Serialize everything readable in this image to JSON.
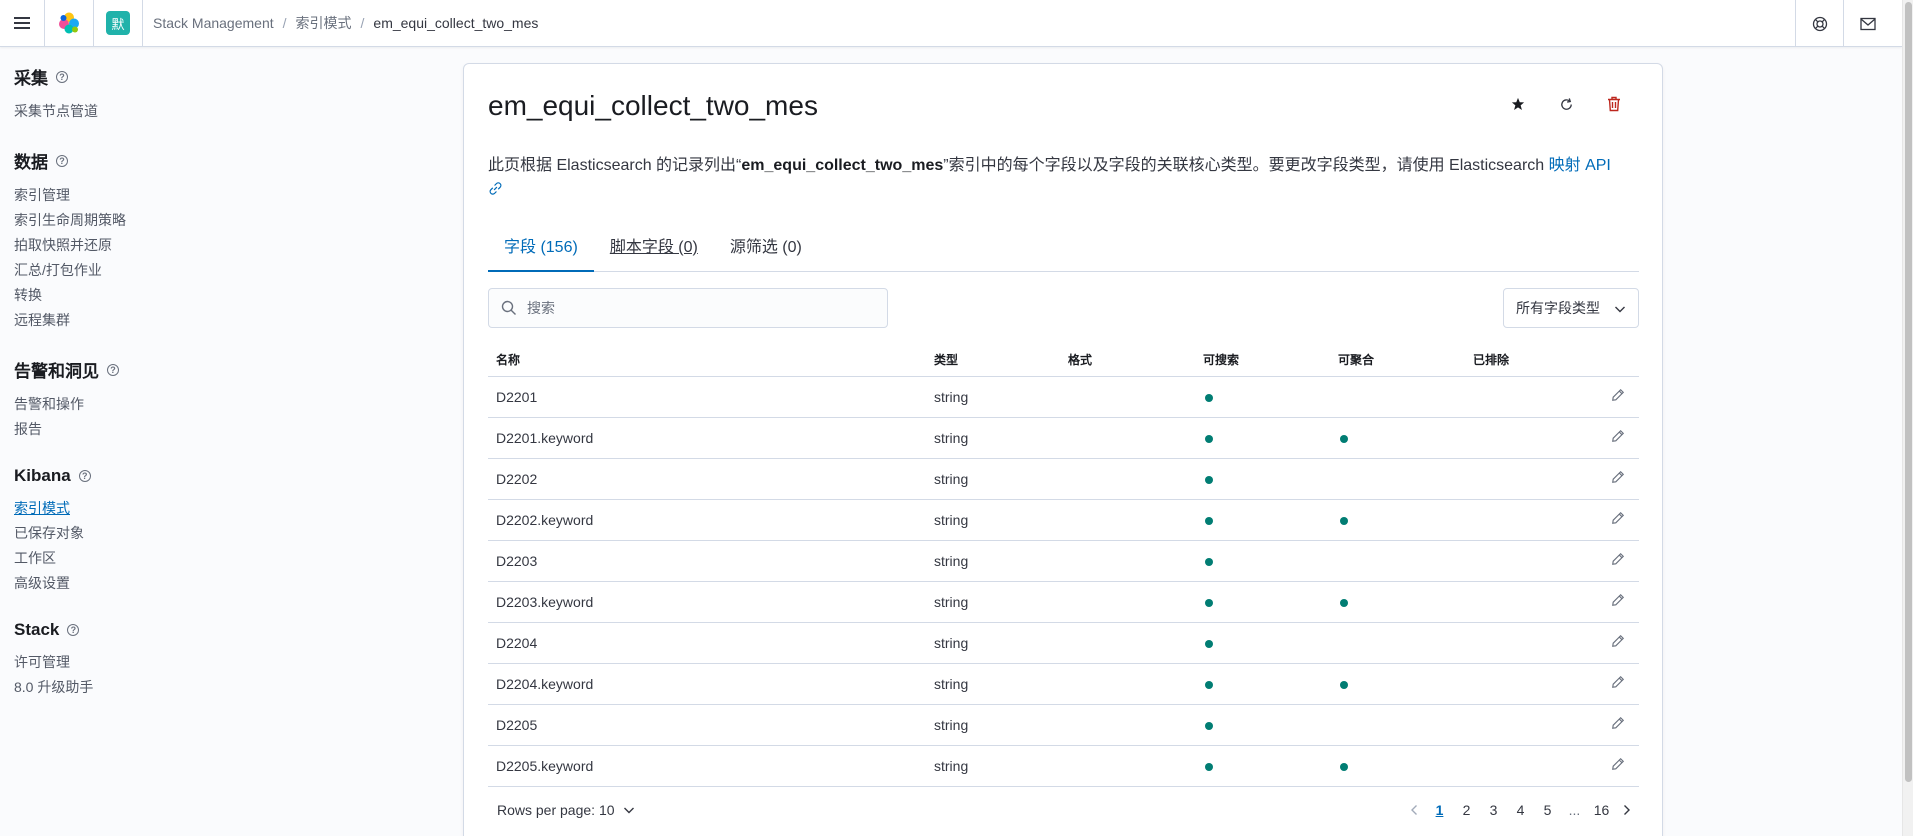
{
  "header": {
    "space_initial": "默",
    "breadcrumbs": [
      "Stack Management",
      "索引模式",
      "em_equi_collect_two_mes"
    ]
  },
  "sidebar": {
    "groups": [
      {
        "title": "采集",
        "items": [
          "采集节点管道"
        ]
      },
      {
        "title": "数据",
        "items": [
          "索引管理",
          "索引生命周期策略",
          "拍取快照并还原",
          "汇总/打包作业",
          "转换",
          "远程集群"
        ]
      },
      {
        "title": "告警和洞见",
        "items": [
          "告警和操作",
          "报告"
        ]
      },
      {
        "title": "Kibana",
        "items": [
          "索引模式",
          "已保存对象",
          "工作区",
          "高级设置"
        ]
      },
      {
        "title": "Stack",
        "items": [
          "许可管理",
          "8.0 升级助手"
        ]
      }
    ],
    "active_item": "索引模式"
  },
  "page": {
    "title": "em_equi_collect_two_mes",
    "description_pre": "此页根据 Elasticsearch 的记录列出“",
    "description_bold": "em_equi_collect_two_mes",
    "description_post": "”索引中的每个字段以及字段的关联核心类型。要更改字段类型，请使用 Elasticsearch ",
    "description_link": "映射 API",
    "tabs": [
      "字段 (156)",
      "脚本字段 (0)",
      "源筛选 (0)"
    ],
    "search_placeholder": "搜索",
    "type_filter_label": "所有字段类型"
  },
  "table": {
    "columns": [
      "名称",
      "类型",
      "格式",
      "可搜索",
      "可聚合",
      "已排除"
    ],
    "rows": [
      {
        "name": "D2201",
        "type": "string",
        "searchable": true,
        "aggregatable": false
      },
      {
        "name": "D2201.keyword",
        "type": "string",
        "searchable": true,
        "aggregatable": true
      },
      {
        "name": "D2202",
        "type": "string",
        "searchable": true,
        "aggregatable": false
      },
      {
        "name": "D2202.keyword",
        "type": "string",
        "searchable": true,
        "aggregatable": true
      },
      {
        "name": "D2203",
        "type": "string",
        "searchable": true,
        "aggregatable": false
      },
      {
        "name": "D2203.keyword",
        "type": "string",
        "searchable": true,
        "aggregatable": true
      },
      {
        "name": "D2204",
        "type": "string",
        "searchable": true,
        "aggregatable": false
      },
      {
        "name": "D2204.keyword",
        "type": "string",
        "searchable": true,
        "aggregatable": true
      },
      {
        "name": "D2205",
        "type": "string",
        "searchable": true,
        "aggregatable": false
      },
      {
        "name": "D2205.keyword",
        "type": "string",
        "searchable": true,
        "aggregatable": true
      }
    ]
  },
  "pagination": {
    "rows_per_page_label": "Rows per page: 10",
    "pages": [
      "1",
      "2",
      "3",
      "4",
      "5",
      "...",
      "16"
    ],
    "current_page": "1"
  },
  "colors": {
    "accent": "#006bb8",
    "dot": "#017d73",
    "danger": "#bd271e"
  }
}
